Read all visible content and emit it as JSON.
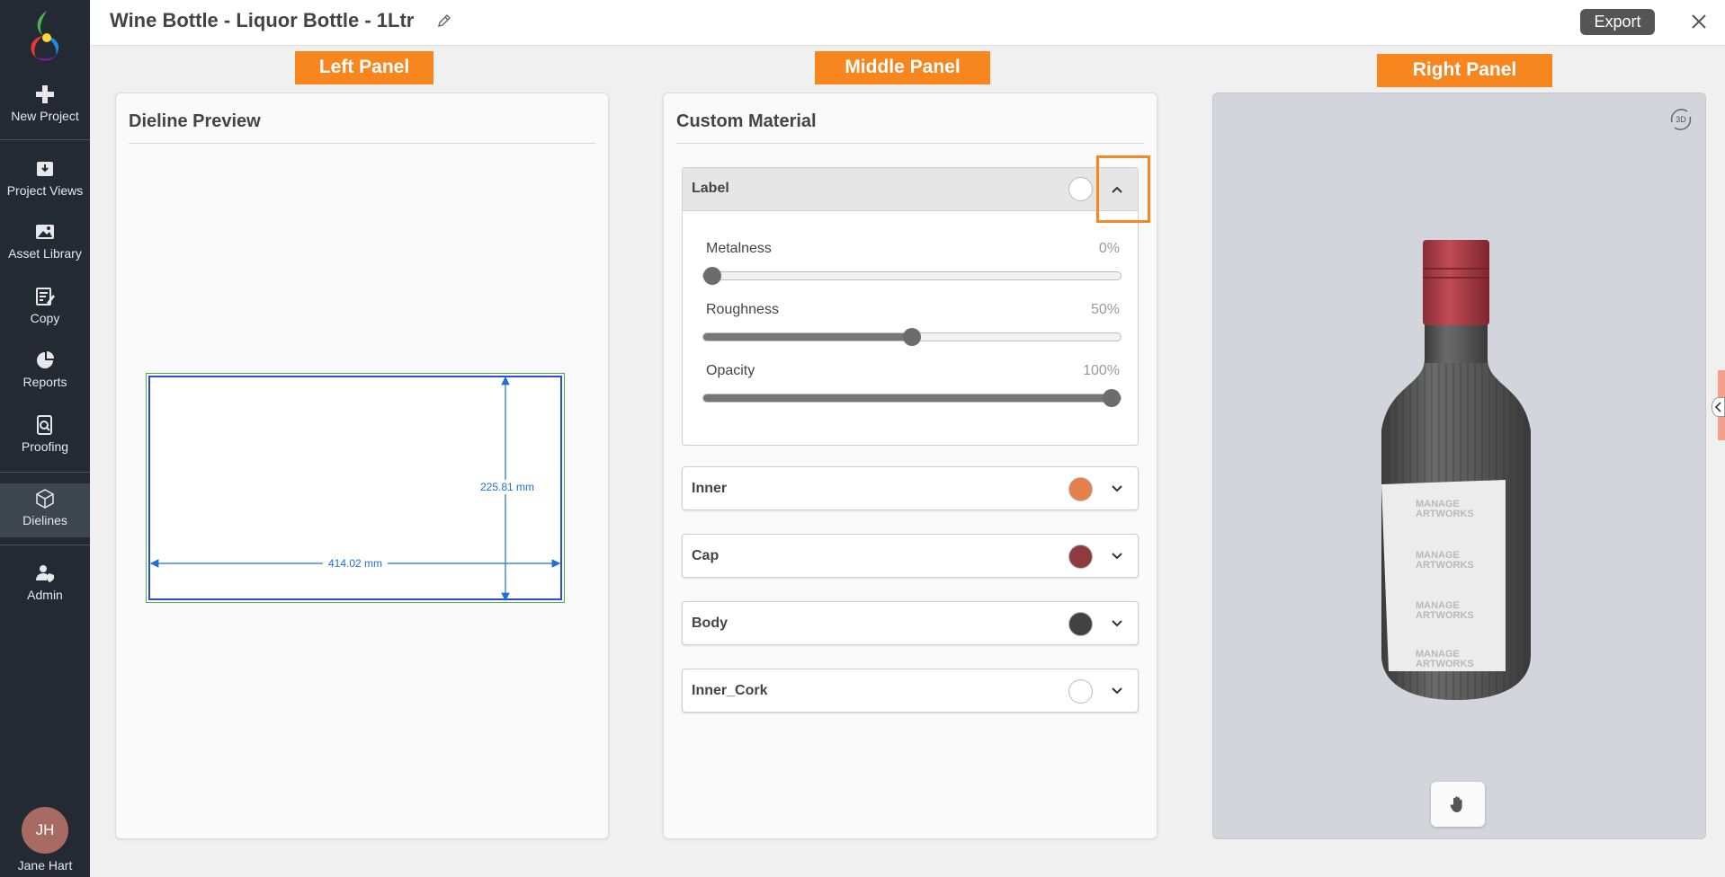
{
  "header": {
    "title": "Wine Bottle - Liquor Bottle - 1Ltr",
    "export_label": "Export"
  },
  "sidebar": {
    "items": [
      {
        "label": "New Project",
        "icon": "plus-icon"
      },
      {
        "label": "Project Views",
        "icon": "inbox-download-icon"
      },
      {
        "label": "Asset Library",
        "icon": "image-icon"
      },
      {
        "label": "Copy",
        "icon": "edit-document-icon"
      },
      {
        "label": "Reports",
        "icon": "pie-chart-icon"
      },
      {
        "label": "Proofing",
        "icon": "document-search-icon"
      },
      {
        "label": "Dielines",
        "icon": "box-3d-icon",
        "active": true
      },
      {
        "label": "Admin",
        "icon": "user-shield-icon"
      }
    ],
    "user": {
      "initials": "JH",
      "name": "Jane Hart"
    }
  },
  "callouts": {
    "left": "Left Panel",
    "middle": "Middle Panel",
    "right": "Right Panel"
  },
  "left_panel": {
    "title": "Dieline Preview",
    "width_label": "414.02 mm",
    "height_label": "225.81 mm"
  },
  "middle_panel": {
    "title": "Custom Material",
    "label_group": {
      "name": "Label",
      "color": "#ffffff",
      "sliders": [
        {
          "label": "Metalness",
          "value_text": "0%",
          "value": 0
        },
        {
          "label": "Roughness",
          "value_text": "50%",
          "value": 50
        },
        {
          "label": "Opacity",
          "value_text": "100%",
          "value": 100
        }
      ]
    },
    "materials": [
      {
        "name": "Inner",
        "color": "#e5824c"
      },
      {
        "name": "Cap",
        "color": "#8e3a3f"
      },
      {
        "name": "Body",
        "color": "#424242"
      },
      {
        "name": "Inner_Cork",
        "color": "#ffffff"
      }
    ]
  },
  "right_panel": {
    "bottle_label_text": [
      "MANAGE",
      "ARTWORKS"
    ],
    "view_mode_icon": "rotate-3d-icon",
    "tool_icon": "hand-pan-icon"
  },
  "colors": {
    "accent": "#f7861f",
    "sidebar_bg": "#232a33",
    "dimension_blue": "#1e6fd9"
  }
}
